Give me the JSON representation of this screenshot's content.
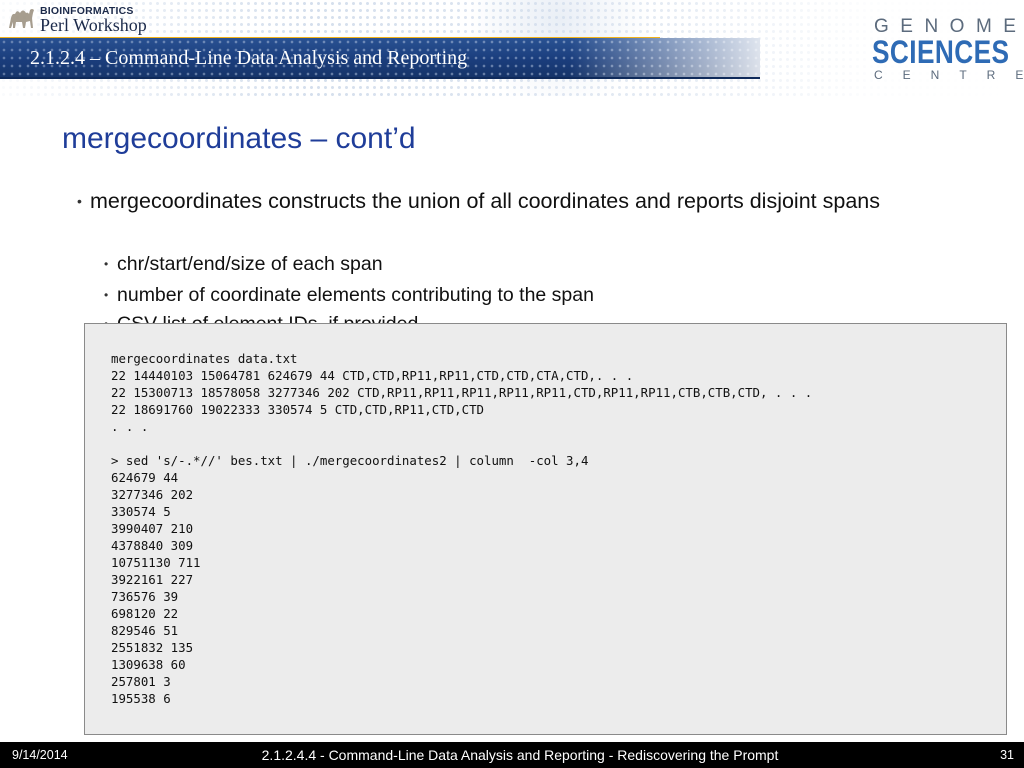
{
  "header": {
    "logo_line1": "BIOINFORMATICS",
    "logo_line2": "Perl Workshop",
    "title": "2.1.2.4 – Command-Line Data Analysis and Reporting",
    "gsc_genome": "GENOME",
    "gsc_sciences": "SCIENCES",
    "gsc_centre": "CENTRE",
    "colors": {
      "title_bar": "#1a3d7c",
      "accent": "#f0b21a",
      "brand_blue": "#2e6bb5"
    }
  },
  "slide": {
    "title": "mergecoordinates – cont’d",
    "bullet_main": "mergecoordinates constructs the union of all coordinates and reports disjoint spans",
    "sub_bullets": [
      "chr/start/end/size of each span",
      "number of coordinate elements contributing to the span",
      "CSV list of element IDs, if provided"
    ]
  },
  "code": {
    "lines": [
      "mergecoordinates data.txt",
      "22 14440103 15064781 624679 44 CTD,CTD,RP11,RP11,CTD,CTD,CTA,CTD,. . .",
      "22 15300713 18578058 3277346 202 CTD,RP11,RP11,RP11,RP11,RP11,CTD,RP11,RP11,CTB,CTB,CTD, . . .",
      "22 18691760 19022333 330574 5 CTD,CTD,RP11,CTD,CTD",
      ". . .",
      "",
      "> sed 's/-.*//' bes.txt | ./mergecoordinates2 | column  -col 3,4",
      "624679 44",
      "3277346 202",
      "330574 5",
      "3990407 210",
      "4378840 309",
      "10751130 711",
      "3922161 227",
      "736576 39",
      "698120 22",
      "829546 51",
      "2551832 135",
      "1309638 60",
      "257801 3",
      "195538 6"
    ]
  },
  "footer": {
    "date": "9/14/2014",
    "title": "2.1.2.4.4 - Command-Line Data Analysis and Reporting - Rediscovering the Prompt",
    "page": "31"
  }
}
